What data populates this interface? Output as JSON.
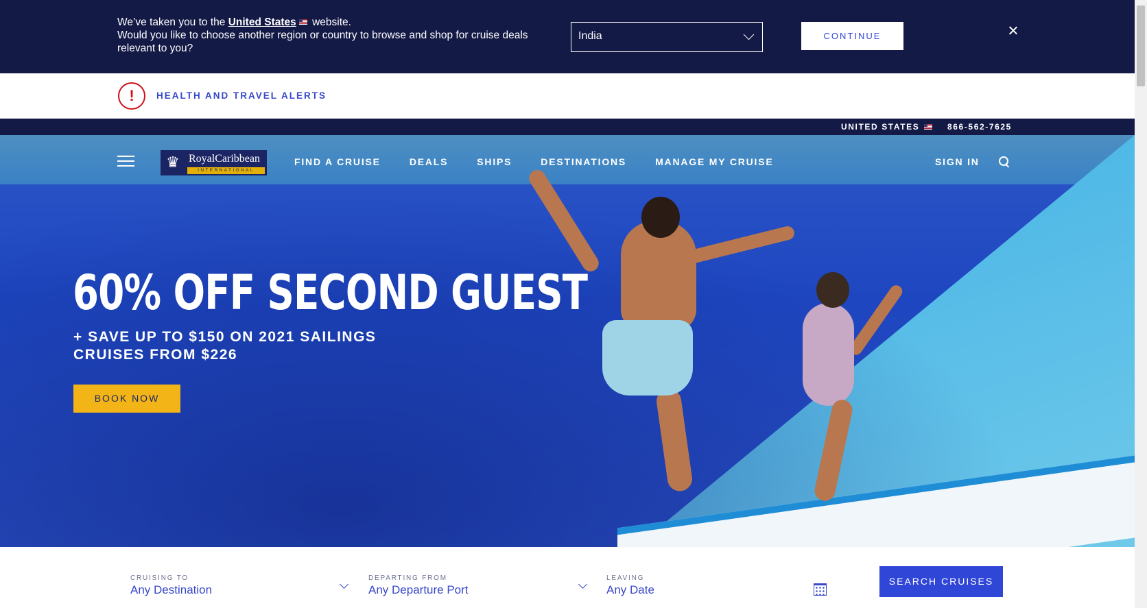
{
  "region_banner": {
    "msg_prefix": "We’ve taken you to the",
    "msg_country": "United States",
    "msg_suffix": "website.",
    "msg_line2": "Would you like to choose another region or country to browse and shop for cruise deals relevant to you?",
    "selected_region": "India",
    "continue_label": "CONTINUE"
  },
  "alert": {
    "icon_glyph": "!",
    "label": "HEALTH AND TRAVEL ALERTS",
    "color": "#d0101a"
  },
  "utility": {
    "country": "UNITED STATES",
    "phone": "866-562-7625"
  },
  "nav": {
    "logo_text": "RoyalCaribbean",
    "logo_sub": "INTERNATIONAL",
    "links": [
      "FIND A CRUISE",
      "DEALS",
      "SHIPS",
      "DESTINATIONS",
      "MANAGE MY CRUISE"
    ],
    "sign_in": "SIGN IN"
  },
  "hero": {
    "title": "60% OFF SECOND GUEST",
    "sub_line1": "+ SAVE UP TO $150 ON 2021 SAILINGS",
    "sub_line2": "CRUISES FROM $226",
    "cta": "BOOK NOW"
  },
  "search": {
    "fields": [
      {
        "label": "CRUISING TO",
        "value": "Any Destination"
      },
      {
        "label": "DEPARTING FROM",
        "value": "Any Departure Port"
      },
      {
        "label": "LEAVING",
        "value": "Any Date"
      }
    ],
    "button": "SEARCH CRUISES"
  },
  "colors": {
    "navy": "#141a46",
    "accent_blue": "#2f46d6",
    "cta_yellow": "#f2b416",
    "link_blue": "#3848c9"
  }
}
